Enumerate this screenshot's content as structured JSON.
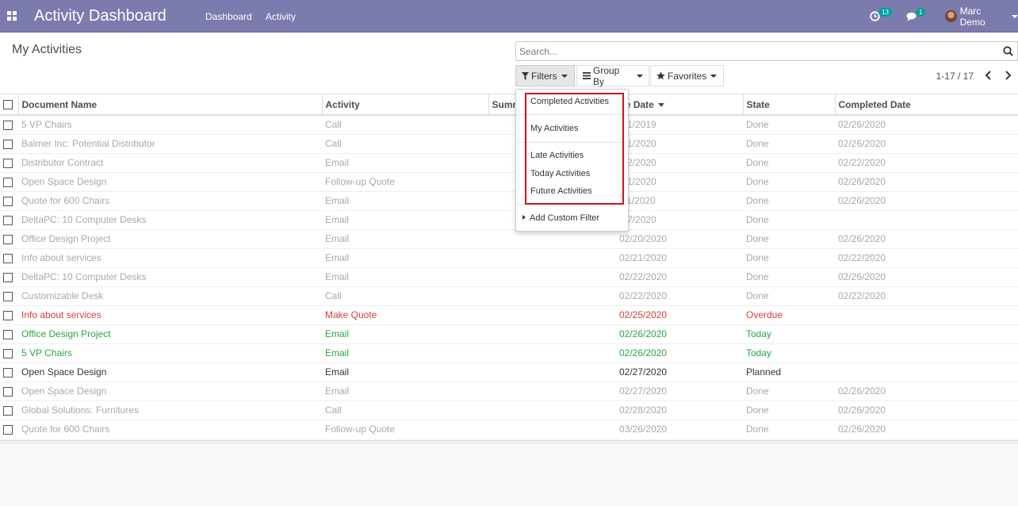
{
  "navbar": {
    "title": "Activity Dashboard",
    "menu": [
      "Dashboard",
      "Activity"
    ],
    "activity_count": "13",
    "message_count": "1",
    "user_name": "Marc Demo",
    "color": "#7c7bad"
  },
  "control_panel": {
    "title": "My Activities",
    "search_placeholder": "Search...",
    "filters_label": "Filters",
    "group_by_label": "Group By",
    "favorites_label": "Favorites",
    "pager": "1-17 / 17"
  },
  "filters_menu": {
    "items": [
      "Completed Activities",
      "My Activities",
      "Late Activities",
      "Today Activities",
      "Future Activities"
    ],
    "add_custom": "Add Custom Filter"
  },
  "table": {
    "columns": [
      "Document Name",
      "Activity",
      "Summ",
      "ue Date",
      "State",
      "Completed Date"
    ],
    "rows": [
      {
        "name": "5 VP Chairs",
        "activity": "Call",
        "due": "/01/2019",
        "state": "Done",
        "completed": "02/26/2020",
        "status": "done"
      },
      {
        "name": "Balmer Inc: Potential Distributor",
        "activity": "Call",
        "due": "/01/2020",
        "state": "Done",
        "completed": "02/26/2020",
        "status": "done"
      },
      {
        "name": "Distributor Contract",
        "activity": "Email",
        "due": "/22/2020",
        "state": "Done",
        "completed": "02/22/2020",
        "status": "done"
      },
      {
        "name": "Open Space Design",
        "activity": "Follow-up Quote",
        "due": "/01/2020",
        "state": "Done",
        "completed": "02/26/2020",
        "status": "done"
      },
      {
        "name": "Quote for 600 Chairs",
        "activity": "Email",
        "due": "/11/2020",
        "state": "Done",
        "completed": "02/26/2020",
        "status": "done"
      },
      {
        "name": "DeltaPC: 10 Computer Desks",
        "activity": "Email",
        "due": "/17/2020",
        "state": "Done",
        "completed": "",
        "status": "done"
      },
      {
        "name": "Office Design Project",
        "activity": "Email",
        "due": "02/20/2020",
        "state": "Done",
        "completed": "02/26/2020",
        "status": "done"
      },
      {
        "name": "Info about services",
        "activity": "Email",
        "due": "02/21/2020",
        "state": "Done",
        "completed": "02/22/2020",
        "status": "done"
      },
      {
        "name": "DeltaPC: 10 Computer Desks",
        "activity": "Email",
        "due": "02/22/2020",
        "state": "Done",
        "completed": "02/26/2020",
        "status": "done"
      },
      {
        "name": "Customizable Desk",
        "activity": "Call",
        "due": "02/22/2020",
        "state": "Done",
        "completed": "02/22/2020",
        "status": "done"
      },
      {
        "name": "Info about services",
        "activity": "Make Quote",
        "due": "02/25/2020",
        "state": "Overdue",
        "completed": "",
        "status": "overdue"
      },
      {
        "name": "Office Design Project",
        "activity": "Email",
        "due": "02/26/2020",
        "state": "Today",
        "completed": "",
        "status": "today"
      },
      {
        "name": "5 VP Chairs",
        "activity": "Email",
        "due": "02/26/2020",
        "state": "Today",
        "completed": "",
        "status": "today"
      },
      {
        "name": "Open Space Design",
        "activity": "Email",
        "due": "02/27/2020",
        "state": "Planned",
        "completed": "",
        "status": "planned"
      },
      {
        "name": "Open Space Design",
        "activity": "Email",
        "due": "02/27/2020",
        "state": "Done",
        "completed": "02/26/2020",
        "status": "done"
      },
      {
        "name": "Global Solutions: Furnitures",
        "activity": "Call",
        "due": "02/28/2020",
        "state": "Done",
        "completed": "02/26/2020",
        "status": "done"
      },
      {
        "name": "Quote for 600 Chairs",
        "activity": "Follow-up Quote",
        "due": "03/26/2020",
        "state": "Done",
        "completed": "02/26/2020",
        "status": "done"
      }
    ]
  }
}
